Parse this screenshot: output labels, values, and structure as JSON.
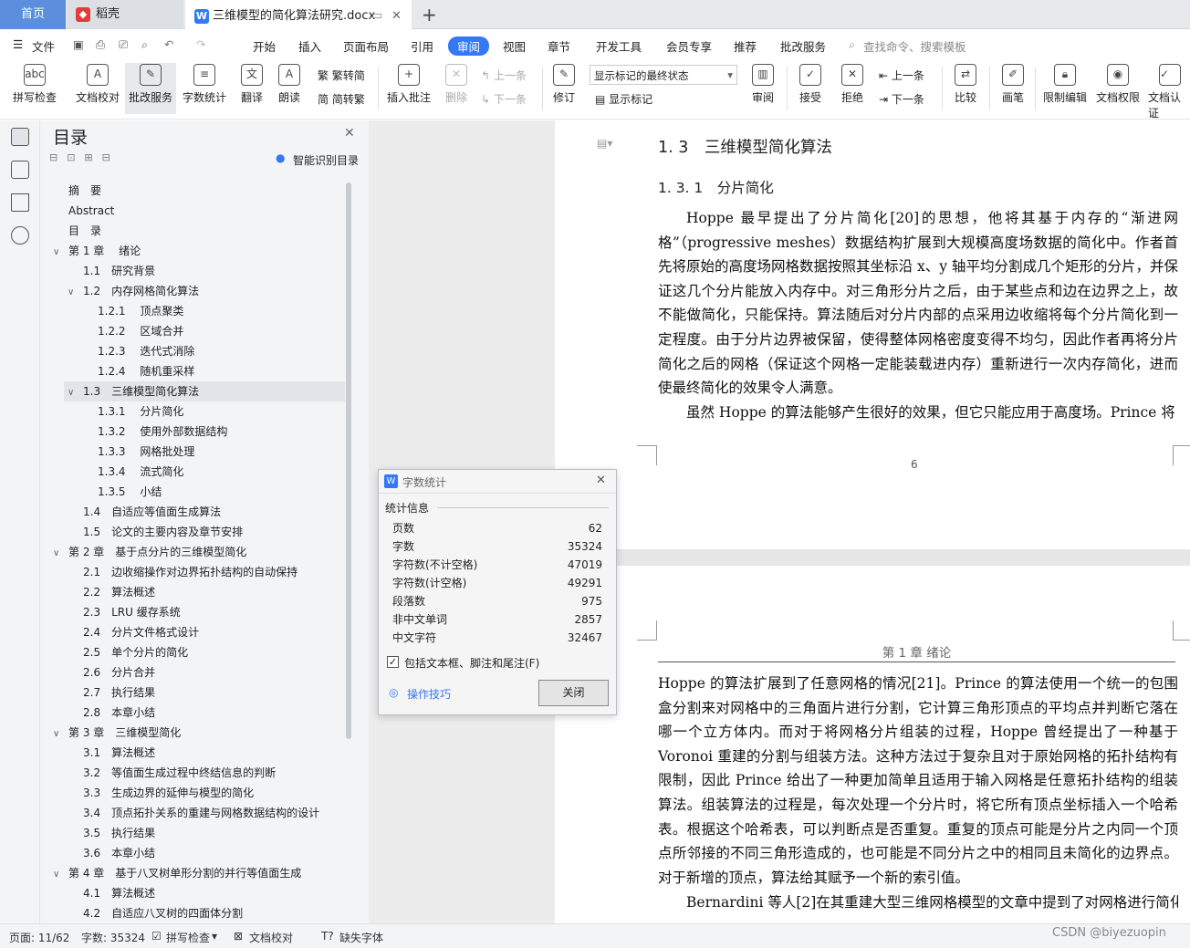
{
  "tabs": {
    "home": "首页",
    "daoke": "稻壳",
    "doc": "三维模型的简化算法研究.docx",
    "new": "+"
  },
  "menu": {
    "file": "文件",
    "items": [
      "开始",
      "插入",
      "页面布局",
      "引用",
      "审阅",
      "视图",
      "章节",
      "开发工具",
      "会员专享",
      "推荐",
      "批改服务"
    ],
    "search": "查找命令、搜索模板"
  },
  "ribbon": {
    "spell": "拼写检查",
    "proof": "文档校对",
    "correct": "批改服务",
    "count": "字数统计",
    "translate": "翻译",
    "read": "朗读",
    "trad": "繁转简",
    "simp": "简转繁",
    "insert_comment": "插入批注",
    "delete": "删除",
    "prev": "上一条",
    "next": "下一条",
    "revise": "修订",
    "markup_state": "显示标记的最终状态",
    "show_markup": "显示标记",
    "review": "审阅",
    "accept": "接受",
    "reject": "拒绝",
    "prev2": "上一条",
    "next2": "下一条",
    "compare": "比较",
    "pen": "画笔",
    "restrict": "限制编辑",
    "rights": "文档权限",
    "auth": "文档认证"
  },
  "toc": {
    "title": "目录",
    "smart": "智能识别目录",
    "items": [
      {
        "t": "摘　要",
        "l": 0,
        "c": false
      },
      {
        "t": "Abstract",
        "l": 0,
        "c": false
      },
      {
        "t": "目　录",
        "l": 0,
        "c": false
      },
      {
        "t": "第 1 章　 绪论",
        "l": 0,
        "c": true
      },
      {
        "t": "1.1　研究背景",
        "l": 1,
        "c": false
      },
      {
        "t": "1.2　内存网格简化算法",
        "l": 1,
        "c": true
      },
      {
        "t": "1.2.1　 顶点聚类",
        "l": 2,
        "c": false
      },
      {
        "t": "1.2.2　 区域合并",
        "l": 2,
        "c": false
      },
      {
        "t": "1.2.3　 迭代式消除",
        "l": 2,
        "c": false
      },
      {
        "t": "1.2.4　 随机重采样",
        "l": 2,
        "c": false
      },
      {
        "t": "1.3　三维模型简化算法",
        "l": 1,
        "c": true
      },
      {
        "t": "1.3.1　 分片简化",
        "l": 2,
        "c": false
      },
      {
        "t": "1.3.2　 使用外部数据结构",
        "l": 2,
        "c": false
      },
      {
        "t": "1.3.3　 网格批处理",
        "l": 2,
        "c": false
      },
      {
        "t": "1.3.4　 流式简化",
        "l": 2,
        "c": false
      },
      {
        "t": "1.3.5　 小结",
        "l": 2,
        "c": false
      },
      {
        "t": "1.4　自适应等值面生成算法",
        "l": 1,
        "c": false
      },
      {
        "t": "1.5　论文的主要内容及章节安排",
        "l": 1,
        "c": false
      },
      {
        "t": "第 2 章　基于点分片的三维模型简化",
        "l": 0,
        "c": true
      },
      {
        "t": "2.1　边收缩操作对边界拓扑结构的自动保持",
        "l": 1,
        "c": false
      },
      {
        "t": "2.2　算法概述",
        "l": 1,
        "c": false
      },
      {
        "t": "2.3　LRU 缓存系统",
        "l": 1,
        "c": false
      },
      {
        "t": "2.4　分片文件格式设计",
        "l": 1,
        "c": false
      },
      {
        "t": "2.5　单个分片的简化",
        "l": 1,
        "c": false
      },
      {
        "t": "2.6　分片合并",
        "l": 1,
        "c": false
      },
      {
        "t": "2.7　执行结果",
        "l": 1,
        "c": false
      },
      {
        "t": "2.8　本章小结",
        "l": 1,
        "c": false
      },
      {
        "t": "第 3 章　三维模型简化",
        "l": 0,
        "c": true
      },
      {
        "t": "3.1　算法概述",
        "l": 1,
        "c": false
      },
      {
        "t": "3.2　等值面生成过程中终结信息的判断",
        "l": 1,
        "c": false
      },
      {
        "t": "3.3　生成边界的延伸与模型的简化",
        "l": 1,
        "c": false
      },
      {
        "t": "3.4　顶点拓扑关系的重建与网格数据结构的设计",
        "l": 1,
        "c": false
      },
      {
        "t": "3.5　执行结果",
        "l": 1,
        "c": false
      },
      {
        "t": "3.6　本章小结",
        "l": 1,
        "c": false
      },
      {
        "t": "第 4 章　基于八叉树单形分割的并行等值面生成",
        "l": 0,
        "c": true
      },
      {
        "t": "4.1　算法概述",
        "l": 1,
        "c": false
      },
      {
        "t": "4.2　自适应八叉树的四面体分割",
        "l": 1,
        "c": false
      }
    ]
  },
  "doc": {
    "h2": "1. 3　三维模型简化算法",
    "h3": "1. 3. 1　分片简化",
    "p1": "Hoppe 最早提出了分片简化[20]的思想，他将其基于内存的“渐进网格”（progressive meshes）数据结构扩展到大规模高度场数据的简化中。作者首先将原始的高度场网格数据按照其坐标沿 x、y 轴平均分割成几个矩形的分片，并保证这几个分片能放入内存中。对三角形分片之后，由于某些点和边在边界之上，故不能做简化，只能保持。算法随后对分片内部的点采用边收缩将每个分片简化到一定程度。由于分片边界被保留，使得整体网格密度变得不均匀，因此作者再将分片简化之后的网格（保证这个网格一定能装载进内存）重新进行一次内存简化，进而使最终简化的效果令人满意。",
    "p2": "虽然 Hoppe 的算法能够产生很好的效果，但它只能应用于高度场。Prince 将",
    "page_num": "6",
    "header2": "第 1 章 绪论",
    "p3": "Hoppe 的算法扩展到了任意网格的情况[21]。Prince 的算法使用一个统一的包围盒分割来对网格中的三角面片进行分割，它计算三角形顶点的平均点并判断它落在哪一个立方体内。而对于将网格分片组装的过程，Hoppe 曾经提出了一种基于 Voronoi 重建的分割与组装方法。这种方法过于复杂且对于原始网格的拓扑结构有限制，因此 Prince 给出了一种更加简单且适用于输入网格是任意拓扑结构的组装算法。组装算法的过程是，每次处理一个分片时，将它所有顶点坐标插入一个哈希表。根据这个哈希表，可以判断点是否重复。重复的顶点可能是分片之内同一个顶点所邻接的不同三角形造成的，也可能是不同分片之中的相同且未简化的边界点。对于新增的顶点，算法给其赋予一个新的索引值。",
    "p4": "Bernardini 等人[2]在其重建大型三维网格模型的文章中提到了对网格进行简化"
  },
  "dialog": {
    "title": "字数统计",
    "section": "统计信息",
    "rows": [
      [
        "页数",
        "62"
      ],
      [
        "字数",
        "35324"
      ],
      [
        "字符数(不计空格)",
        "47019"
      ],
      [
        "字符数(计空格)",
        "49291"
      ],
      [
        "段落数",
        "975"
      ],
      [
        "非中文单词",
        "2857"
      ],
      [
        "中文字符",
        "32467"
      ]
    ],
    "checkbox": "包括文本框、脚注和尾注(F)",
    "tips": "操作技巧",
    "close": "关闭"
  },
  "status": {
    "page": "页面: 11/62",
    "words": "字数: 35324",
    "spell": "拼写检查",
    "proof": "文档校对",
    "missing": "缺失字体",
    "watermark": "CSDN @biyezuopin"
  },
  "colors": {
    "accent": "#3478f6",
    "home_tab": "#5b8fde"
  }
}
